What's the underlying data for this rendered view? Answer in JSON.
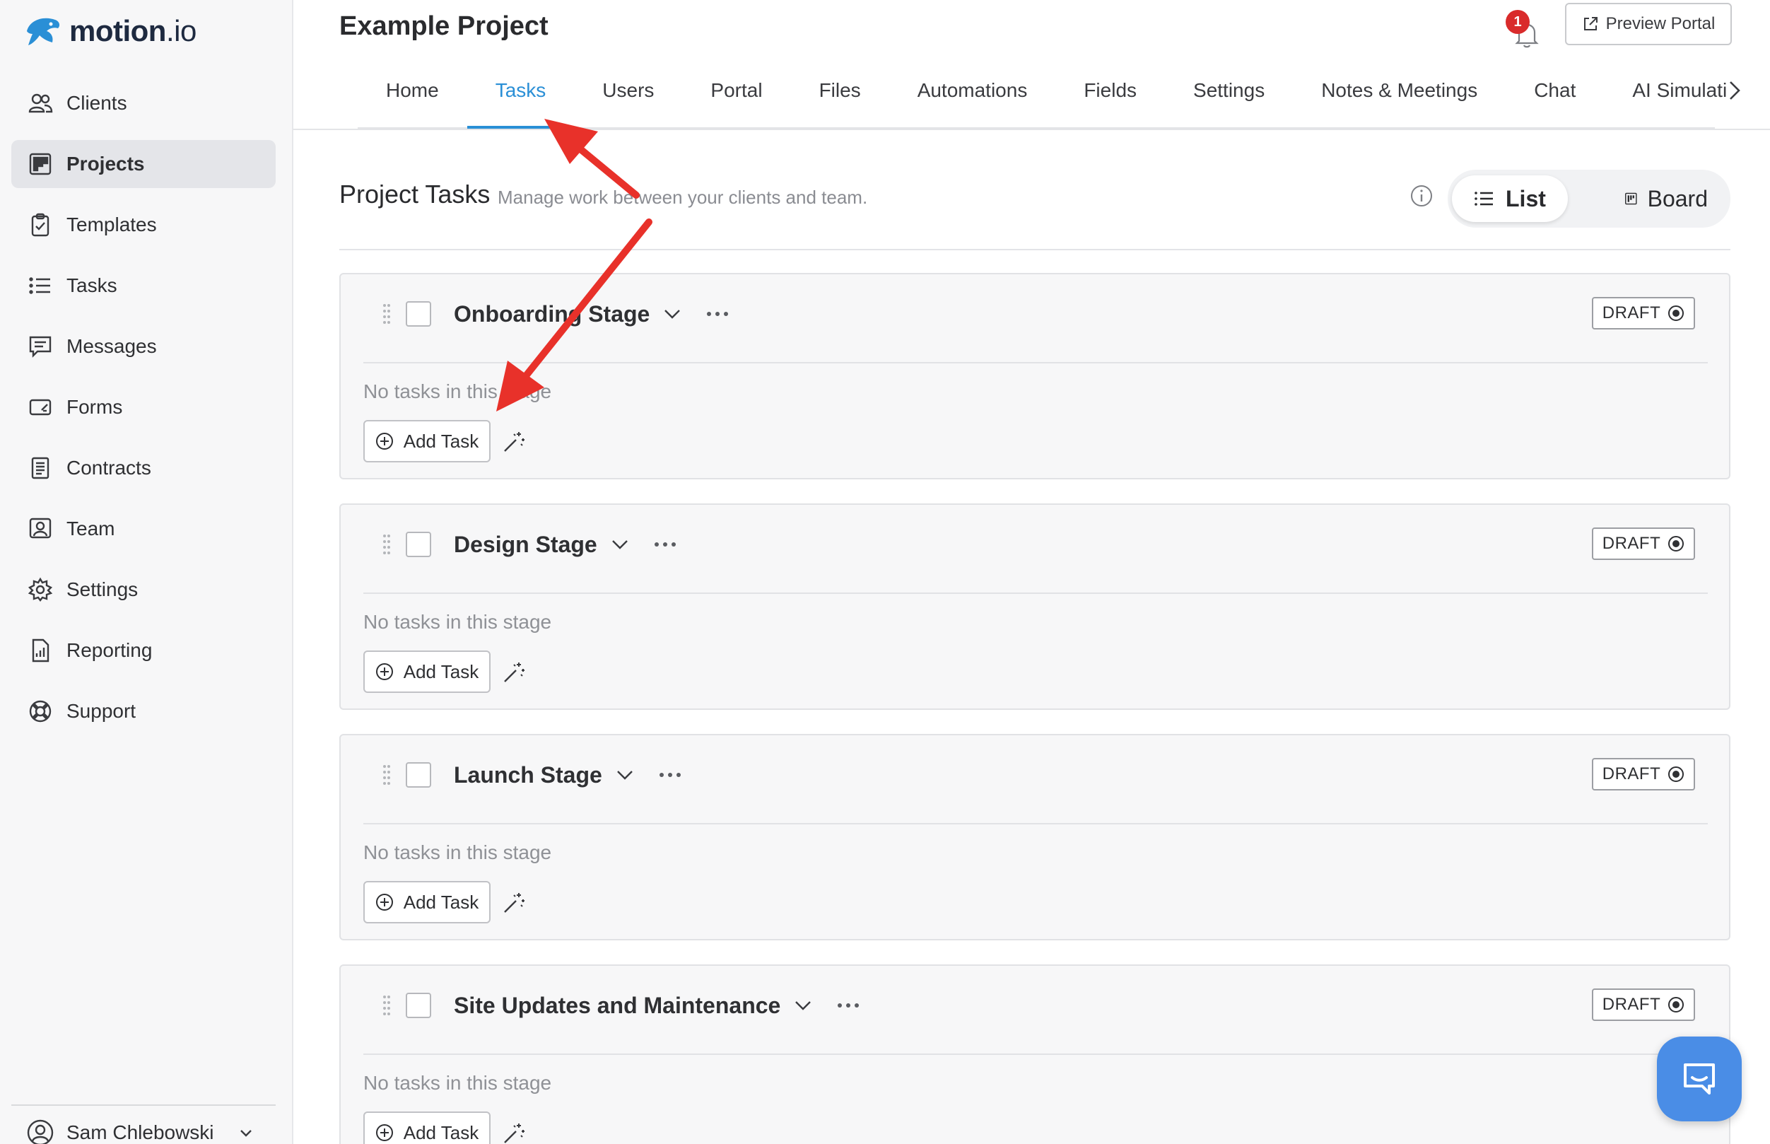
{
  "brand": {
    "name": "motion",
    "tld": ".io"
  },
  "sidebar": {
    "items": [
      {
        "label": "Clients",
        "icon": "users-icon",
        "active": false
      },
      {
        "label": "Projects",
        "icon": "board-icon",
        "active": true
      },
      {
        "label": "Templates",
        "icon": "clipboard-check-icon",
        "active": false
      },
      {
        "label": "Tasks",
        "icon": "list-icon",
        "active": false
      },
      {
        "label": "Messages",
        "icon": "message-icon",
        "active": false
      },
      {
        "label": "Forms",
        "icon": "form-icon",
        "active": false
      },
      {
        "label": "Contracts",
        "icon": "document-icon",
        "active": false
      },
      {
        "label": "Team",
        "icon": "team-icon",
        "active": false
      },
      {
        "label": "Settings",
        "icon": "gear-icon",
        "active": false
      },
      {
        "label": "Reporting",
        "icon": "report-icon",
        "active": false
      },
      {
        "label": "Support",
        "icon": "lifebuoy-icon",
        "active": false
      }
    ],
    "user": {
      "name": "Sam Chlebowski"
    }
  },
  "header": {
    "project_title": "Example Project",
    "notification_count": "1",
    "preview_label": "Preview Portal",
    "tabs": [
      {
        "label": "Home",
        "active": false
      },
      {
        "label": "Tasks",
        "active": true
      },
      {
        "label": "Users",
        "active": false
      },
      {
        "label": "Portal",
        "active": false
      },
      {
        "label": "Files",
        "active": false
      },
      {
        "label": "Automations",
        "active": false
      },
      {
        "label": "Fields",
        "active": false
      },
      {
        "label": "Settings",
        "active": false
      },
      {
        "label": "Notes & Meetings",
        "active": false
      },
      {
        "label": "Chat",
        "active": false
      },
      {
        "label": "AI Simulati",
        "active": false
      }
    ]
  },
  "section": {
    "title": "Project Tasks",
    "subtitle": "Manage work between your clients and team.",
    "views": {
      "list": "List",
      "board": "Board",
      "selected": "list"
    }
  },
  "stages": [
    {
      "title": "Onboarding Stage",
      "status": "DRAFT",
      "empty_text": "No tasks in this stage",
      "add_label": "Add Task"
    },
    {
      "title": "Design Stage",
      "status": "DRAFT",
      "empty_text": "No tasks in this stage",
      "add_label": "Add Task"
    },
    {
      "title": "Launch Stage",
      "status": "DRAFT",
      "empty_text": "No tasks in this stage",
      "add_label": "Add Task"
    },
    {
      "title": "Site Updates and Maintenance",
      "status": "DRAFT",
      "empty_text": "No tasks in this stage",
      "add_label": "Add Task"
    }
  ],
  "colors": {
    "accent": "#2a8fd6",
    "annotation_arrow": "#e8312a",
    "chat_widget": "#4a8de6",
    "badge_red": "#d92b2b"
  }
}
